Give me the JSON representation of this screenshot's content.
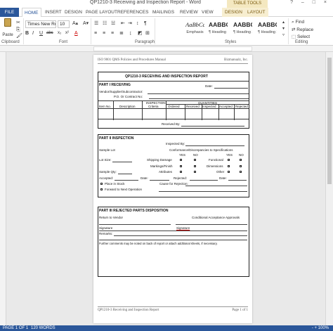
{
  "window": {
    "title": "QP1210-3 Receiving and Inspection Report - Word",
    "table_tools": "TABLE TOOLS",
    "controls": "? – □ ×"
  },
  "tabs": {
    "file": "FILE",
    "home": "HOME",
    "insert": "INSERT",
    "design": "DESIGN",
    "page_layout": "PAGE LAYOUT",
    "references": "REFERENCES",
    "mailings": "MAILINGS",
    "review": "REVIEW",
    "view": "VIEW",
    "tt_design": "DESIGN",
    "tt_layout": "LAYOUT"
  },
  "ribbon": {
    "paste": "Paste",
    "clipboard": "Clipboard",
    "font_name": "Times New Ro",
    "font_size": "10",
    "font": "Font",
    "paragraph": "Paragraph",
    "styles": "Styles",
    "editing": "Editing",
    "bold": "B",
    "italic": "I",
    "underline": "U",
    "strike": "abc",
    "subscript": "x₂",
    "superscript": "x²",
    "font_color": "A",
    "style_items": [
      {
        "preview": "AaBbCcI",
        "name": "Emphasis"
      },
      {
        "preview": "AABBCC",
        "name": "¶ Heading 1"
      },
      {
        "preview": "AABBC",
        "name": "¶ Heading 2"
      },
      {
        "preview": "AABBCC",
        "name": "¶ Heading 3"
      }
    ],
    "find": "Find",
    "replace": "Replace",
    "select": "Select"
  },
  "doc": {
    "header_left": "ISO 9001 QMS Policies and Procedures Manual",
    "header_right": "Bizmanualz, Inc.",
    "form_title": "QP1210-3 RECEIVING AND INSPECTION REPORT",
    "part1": "PART I RECEIVING",
    "date": "Date:",
    "vendor": "Vendor/Supplier/Subcontractor:",
    "po": "P.O.  Or Contract No:",
    "col_item": "Item No.",
    "col_desc": "Description",
    "col_insp": "INSPECTION",
    "col_criteria": "Criteria",
    "col_quant": "QUANTITIES",
    "col_ordered": "Ordered",
    "col_received": "Received",
    "col_inspected": "Inspected",
    "col_accepted": "Accepted",
    "col_rejected": "Rejected",
    "received_by": "Received By:",
    "part2": "PART II INSPECTION",
    "inspected_by": "Inspected By:",
    "sample_lot": "Sample Lot",
    "conformance": "Conformance/Discrepancies to Specifications",
    "yes": "YES",
    "no": "NO",
    "lot_size": "Lot Size:",
    "shipping_damage": "Shipping Damage",
    "functional": "Functional",
    "markings": "Markings/Finish",
    "dimensions": "Dimensions",
    "sample_qty": "Sample Qty:",
    "attributes": "Attributes",
    "other": "Other",
    "accepted": "Accepted:",
    "date2": "Date:",
    "rejected": "Rejected:",
    "date3": "Date:",
    "place_stock": "Place in Stock",
    "cause": "Cause for Rejection:",
    "forward": "Forward to Next Operation",
    "part3": "PART III REJECTED PARTS DISPOSITION",
    "return_vendor": "Return to Vendor",
    "conditional": "Conditional Acceptance Approvals",
    "signature1": "Signature",
    "signature2": "Signature",
    "remarks": "Remarks:",
    "further": "Further comments may be noted on back of report or attach additional sheets, if necessary.",
    "footer_left": "QP1210-3 Receiving and Inspection Report",
    "footer_right": "Page 1 of 1"
  },
  "status": {
    "page": "PAGE 1 OF 1",
    "words": "120 WORDS",
    "zoom": "- + 100%"
  }
}
